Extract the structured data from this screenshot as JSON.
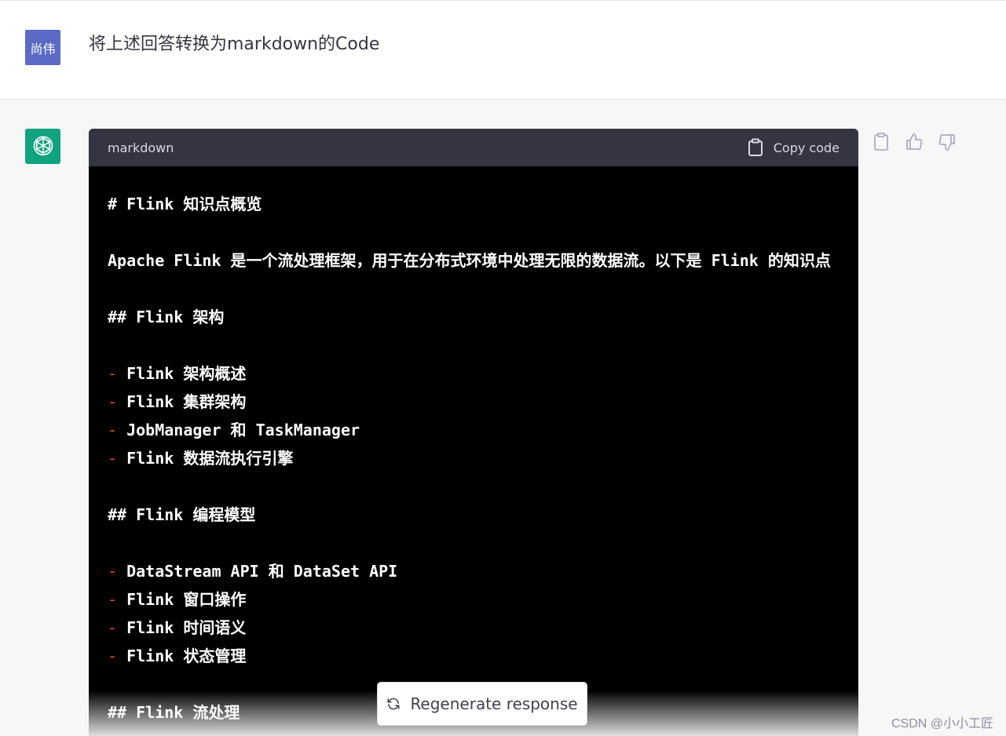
{
  "user": {
    "avatar_text": "尚伟",
    "message": "将上述回答转换为markdown的Code"
  },
  "assistant": {
    "avatar_icon": "openai-logo-icon",
    "code_language": "markdown",
    "copy_label": "Copy code",
    "code_lines": [
      {
        "t": "# Flink 知识点概览"
      },
      {
        "t": ""
      },
      {
        "t": "Apache Flink 是一个流处理框架，用于在分布式环境中处理无限的数据流。以下是 Flink 的知识点"
      },
      {
        "t": ""
      },
      {
        "t": "## Flink 架构"
      },
      {
        "t": ""
      },
      {
        "dash": "-",
        "t": " Flink 架构概述"
      },
      {
        "dash": "-",
        "t": " Flink 集群架构"
      },
      {
        "dash": "-",
        "t": " JobManager 和 TaskManager"
      },
      {
        "dash": "-",
        "t": " Flink 数据流执行引擎"
      },
      {
        "t": ""
      },
      {
        "t": "## Flink 编程模型"
      },
      {
        "t": ""
      },
      {
        "dash": "-",
        "t": " DataStream API 和 DataSet API"
      },
      {
        "dash": "-",
        "t": " Flink 窗口操作"
      },
      {
        "dash": "-",
        "t": " Flink 时间语义"
      },
      {
        "dash": "-",
        "t": " Flink 状态管理"
      },
      {
        "t": ""
      },
      {
        "t": "## Flink 流处理"
      }
    ]
  },
  "actions": {
    "copy_icon": "clipboard-icon",
    "like_icon": "thumbs-up-icon",
    "dislike_icon": "thumbs-down-icon"
  },
  "regenerate": {
    "label": "Regenerate response",
    "icon": "refresh-icon"
  },
  "watermark": "CSDN @小小工匠",
  "colors": {
    "user_avatar": "#5b6ac4",
    "bot_avatar": "#10a37f",
    "code_header": "#343541",
    "code_bg": "#000000",
    "list_dash": "#ef4444"
  }
}
